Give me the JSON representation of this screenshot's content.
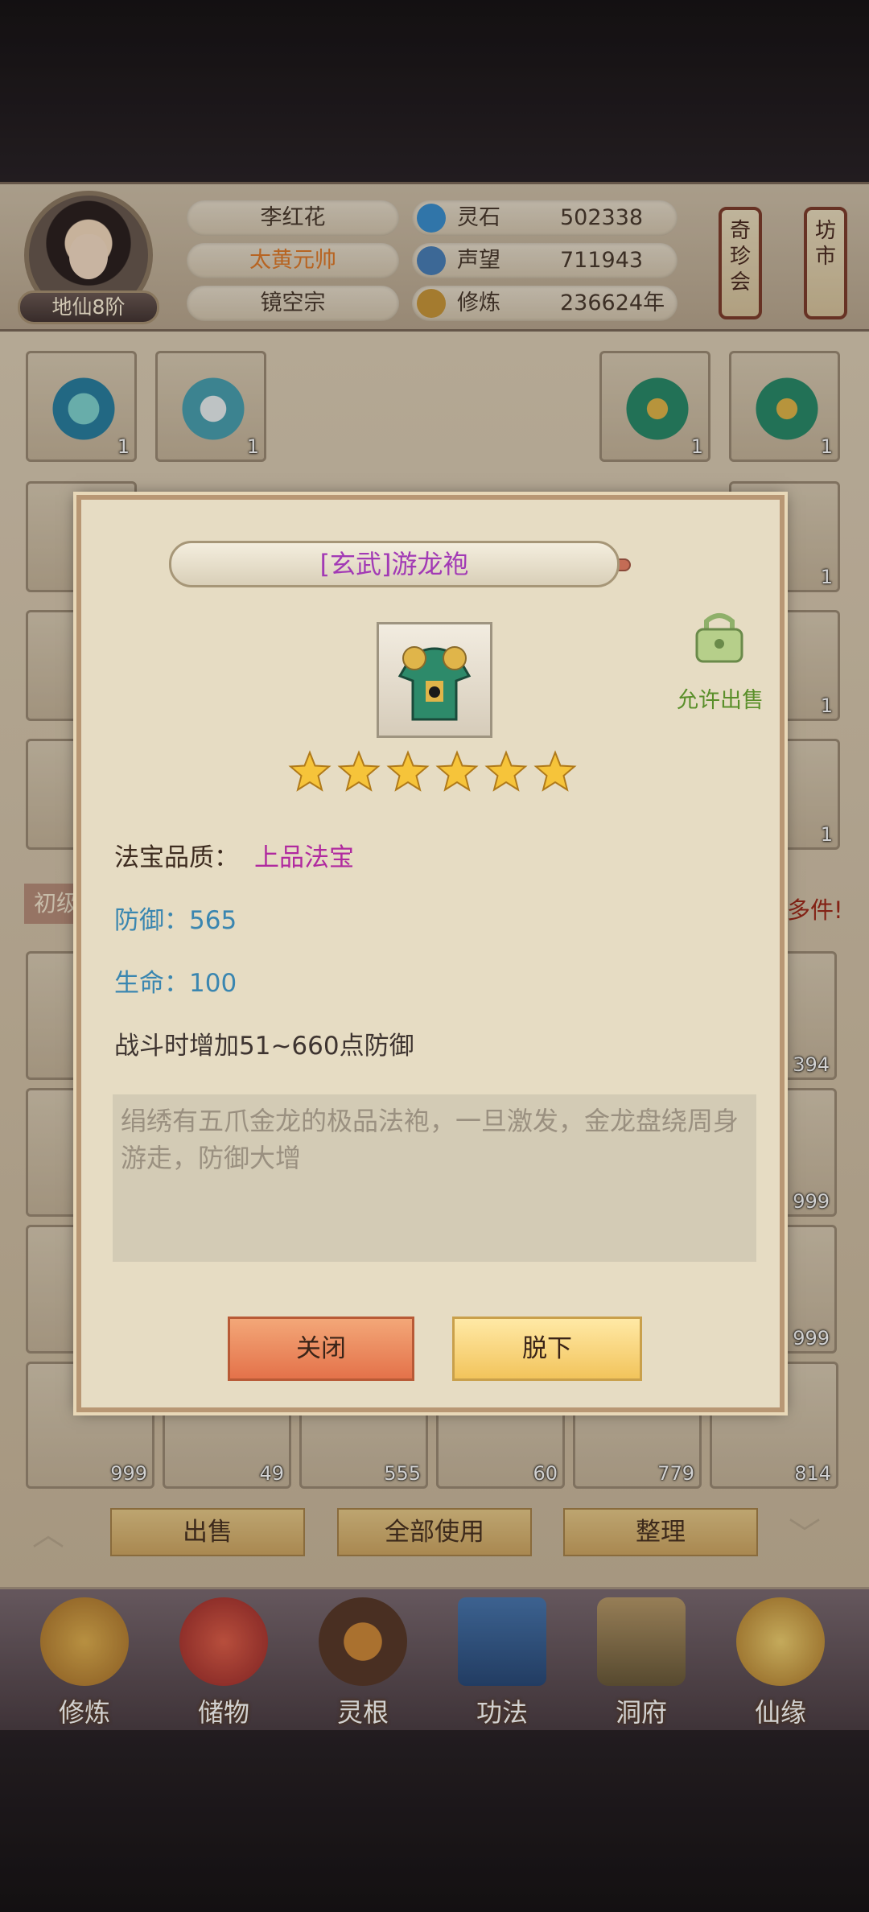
{
  "player": {
    "name": "李红花",
    "title": "太黄元帅",
    "sect": "镜空宗",
    "rank": "地仙8阶"
  },
  "resources": [
    {
      "label": "灵石",
      "value": "502338",
      "icon": "spirit-stone-icon",
      "color": "#3b8fcf"
    },
    {
      "label": "声望",
      "value": "711943",
      "icon": "reputation-icon",
      "color": "#4a7fb8"
    },
    {
      "label": "修炼",
      "value": "236624年",
      "icon": "cultivation-icon",
      "color": "#c8963a"
    }
  ],
  "signs": {
    "treasure_fair": "奇珍会",
    "market": "坊市"
  },
  "inventory": {
    "top_counts": [
      "1",
      "1",
      "1",
      "1"
    ],
    "right_counts": [
      "1",
      "1",
      "1"
    ],
    "grid_right_counts": [
      "394",
      "999",
      "999"
    ],
    "bottom_row_counts": [
      "999",
      "49",
      "555",
      "60",
      "779",
      "814"
    ],
    "banner_left": "初级",
    "banner_right": "多件!"
  },
  "actions": {
    "sell": "出售",
    "use_all": "全部使用",
    "organize": "整理"
  },
  "nav": [
    {
      "label": "修炼",
      "icon": "cultivate-icon"
    },
    {
      "label": "储物",
      "icon": "storage-icon"
    },
    {
      "label": "灵根",
      "icon": "spirit-root-icon"
    },
    {
      "label": "功法",
      "icon": "technique-book-icon"
    },
    {
      "label": "洞府",
      "icon": "cave-dwelling-icon"
    },
    {
      "label": "仙缘",
      "icon": "fate-icon"
    }
  ],
  "dialog": {
    "item_name": "[玄武]游龙袍",
    "allow_sell": "允许出售",
    "stars": 6,
    "quality_label": "法宝品质：",
    "quality_value": "上品法宝",
    "defense": "防御：565",
    "health": "生命：100",
    "effect": "战斗时增加51~660点防御",
    "description": "绢绣有五爪金龙的极品法袍，一旦激发，金龙盘绕周身游走，防御大增",
    "close_button": "关闭",
    "unequip_button": "脱下"
  }
}
